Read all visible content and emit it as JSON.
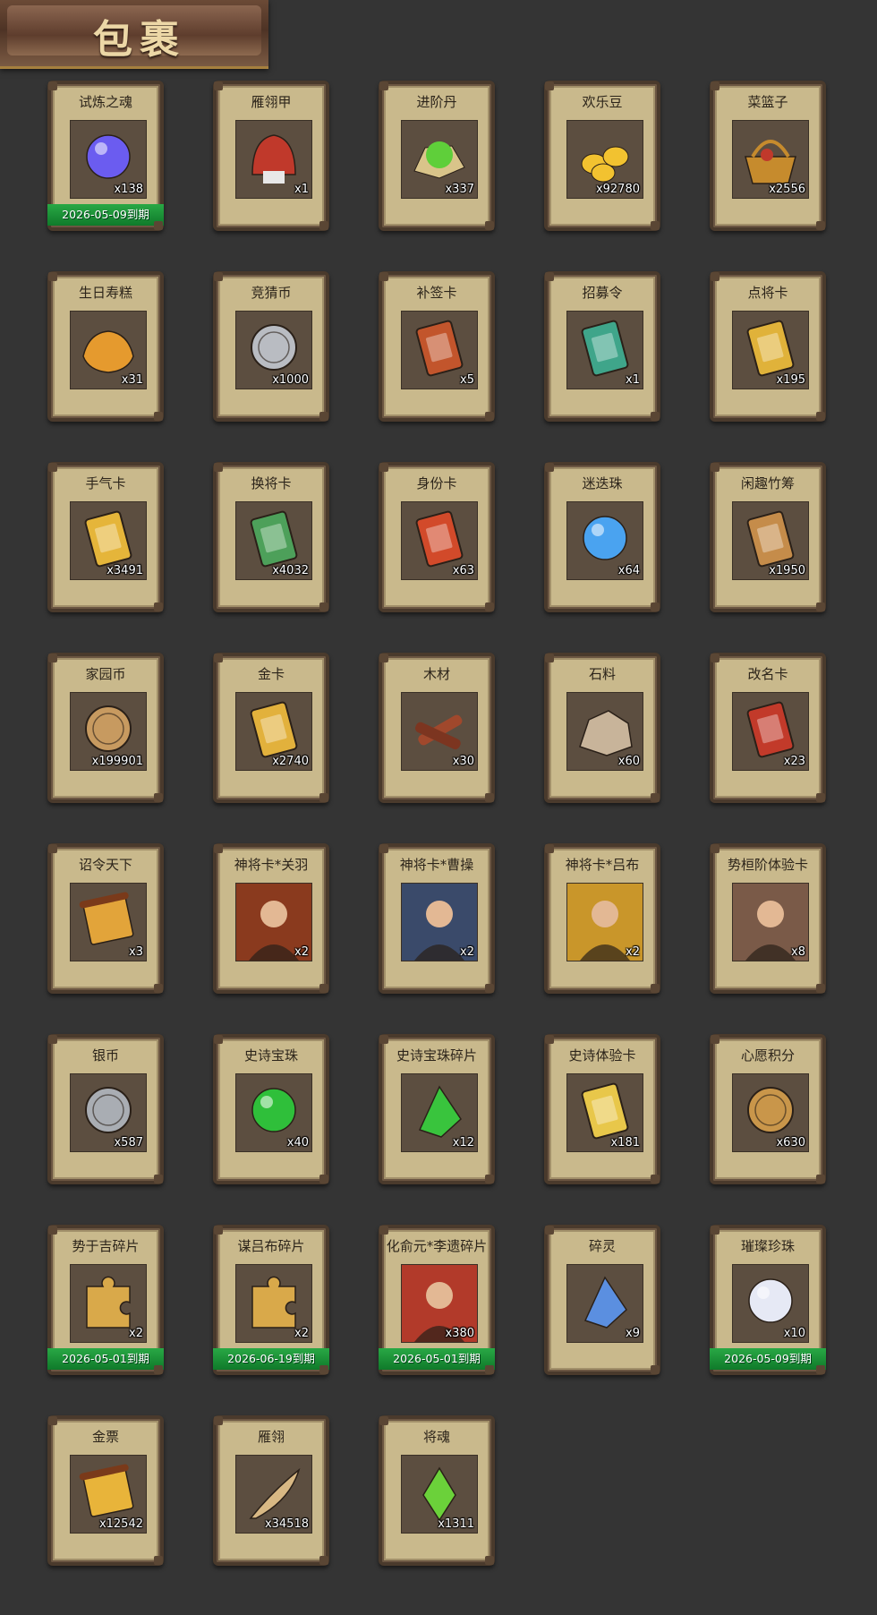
{
  "header": {
    "title": "包裹"
  },
  "items": [
    {
      "name": "试炼之魂",
      "count": "x138",
      "expiry": "2026-05-09到期",
      "icon": "purple-orb-icon",
      "color": "#6b5cf0"
    },
    {
      "name": "雁翎甲",
      "count": "x1",
      "expiry": "",
      "icon": "armor-helmet-icon",
      "color": "#c0392b"
    },
    {
      "name": "进阶丹",
      "count": "x337",
      "expiry": "",
      "icon": "green-pill-icon",
      "color": "#5fcf3a"
    },
    {
      "name": "欢乐豆",
      "count": "x92780",
      "expiry": "",
      "icon": "gold-beans-icon",
      "color": "#f2c230"
    },
    {
      "name": "菜篮子",
      "count": "x2556",
      "expiry": "",
      "icon": "basket-icon",
      "color": "#c68b2d"
    },
    {
      "name": "生日寿糕",
      "count": "x31",
      "expiry": "",
      "icon": "cake-icon",
      "color": "#e59a2e"
    },
    {
      "name": "竞猜币",
      "count": "x1000",
      "expiry": "",
      "icon": "silver-coin-icon",
      "color": "#b9bcc2"
    },
    {
      "name": "补签卡",
      "count": "x5",
      "expiry": "",
      "icon": "sign-card-icon",
      "color": "#c2552c"
    },
    {
      "name": "招募令",
      "count": "x1",
      "expiry": "",
      "icon": "recruit-token-icon",
      "color": "#3fa58a"
    },
    {
      "name": "点将卡",
      "count": "x195",
      "expiry": "",
      "icon": "general-card-icon",
      "color": "#e0b23a"
    },
    {
      "name": "手气卡",
      "count": "x3491",
      "expiry": "",
      "icon": "luck-card-icon",
      "color": "#e5b53a"
    },
    {
      "name": "换将卡",
      "count": "x4032",
      "expiry": "",
      "icon": "swap-card-icon",
      "color": "#4da05a"
    },
    {
      "name": "身份卡",
      "count": "x63",
      "expiry": "",
      "icon": "mask-card-icon",
      "color": "#d24a2a"
    },
    {
      "name": "迷迭珠",
      "count": "x64",
      "expiry": "",
      "icon": "blue-orb-icon",
      "color": "#4aa3f0"
    },
    {
      "name": "闲趣竹筹",
      "count": "x1950",
      "expiry": "",
      "icon": "bamboo-token-icon",
      "color": "#c58c4a"
    },
    {
      "name": "家园币",
      "count": "x199901",
      "expiry": "",
      "icon": "bronze-coin-icon",
      "color": "#c79a60"
    },
    {
      "name": "金卡",
      "count": "x2740",
      "expiry": "",
      "icon": "gold-card-icon",
      "color": "#e2b13c"
    },
    {
      "name": "木材",
      "count": "x30",
      "expiry": "",
      "icon": "wood-icon",
      "color": "#a0482c"
    },
    {
      "name": "石料",
      "count": "x60",
      "expiry": "",
      "icon": "stone-icon",
      "color": "#c8b49a"
    },
    {
      "name": "改名卡",
      "count": "x23",
      "expiry": "",
      "icon": "rename-tag-icon",
      "color": "#c23a2a"
    },
    {
      "name": "诏令天下",
      "count": "x3",
      "expiry": "",
      "icon": "scroll-icon",
      "color": "#e2a43a"
    },
    {
      "name": "神将卡*关羽",
      "count": "x2",
      "expiry": "",
      "icon": "guanyu-portrait-icon",
      "color": "#8a3a1e"
    },
    {
      "name": "神将卡*曹操",
      "count": "x2",
      "expiry": "",
      "icon": "caocao-portrait-icon",
      "color": "#3a4a6a"
    },
    {
      "name": "神将卡*吕布",
      "count": "x2",
      "expiry": "",
      "icon": "lvbu-portrait-icon",
      "color": "#c9962a"
    },
    {
      "name": "势桓阶体验卡",
      "count": "x8",
      "expiry": "",
      "icon": "trial-portrait-icon",
      "color": "#7a5a48"
    },
    {
      "name": "银币",
      "count": "x587",
      "expiry": "",
      "icon": "silver-coins-icon",
      "color": "#a9adb3"
    },
    {
      "name": "史诗宝珠",
      "count": "x40",
      "expiry": "",
      "icon": "green-jewel-icon",
      "color": "#2fbf3a"
    },
    {
      "name": "史诗宝珠碎片",
      "count": "x12",
      "expiry": "",
      "icon": "green-shard-icon",
      "color": "#39c43d"
    },
    {
      "name": "史诗体验卡",
      "count": "x181",
      "expiry": "",
      "icon": "gold-ticket-icon",
      "color": "#e8c74a"
    },
    {
      "name": "心愿积分",
      "count": "x630",
      "expiry": "",
      "icon": "heart-coin-icon",
      "color": "#c9964a"
    },
    {
      "name": "势于吉碎片",
      "count": "x2",
      "expiry": "",
      "icon": "puzzle-piece-icon",
      "color": "#d9a94a"
    },
    {
      "name": "谋吕布碎片",
      "count": "x2",
      "expiry": "",
      "icon": "puzzle-piece-icon",
      "color": "#d9a94a"
    },
    {
      "name": "化俞元*李遗碎片",
      "count": "x380",
      "expiry": "2026-05-01到期",
      "icon": "hero-portrait-icon",
      "color": "#b23a2a"
    },
    {
      "name": "碎灵",
      "count": "x9",
      "expiry": "",
      "icon": "blue-crystal-icon",
      "color": "#5b8fe0"
    },
    {
      "name": "璀璨珍珠",
      "count": "x10",
      "expiry": "2026-05-09到期",
      "icon": "pearl-icon",
      "color": "#e6e9f5"
    },
    {
      "name": "金票",
      "count": "x12542",
      "expiry": "",
      "icon": "gold-scroll-icon",
      "color": "#e8b43a"
    },
    {
      "name": "雁翎",
      "count": "x34518",
      "expiry": "",
      "icon": "feather-icon",
      "color": "#d8b884"
    },
    {
      "name": "将魂",
      "count": "x1311",
      "expiry": "",
      "icon": "green-soul-icon",
      "color": "#6bd13a"
    }
  ],
  "expiry_extra": {
    "30": "2026-05-01到期",
    "31": "2026-06-19到期"
  }
}
